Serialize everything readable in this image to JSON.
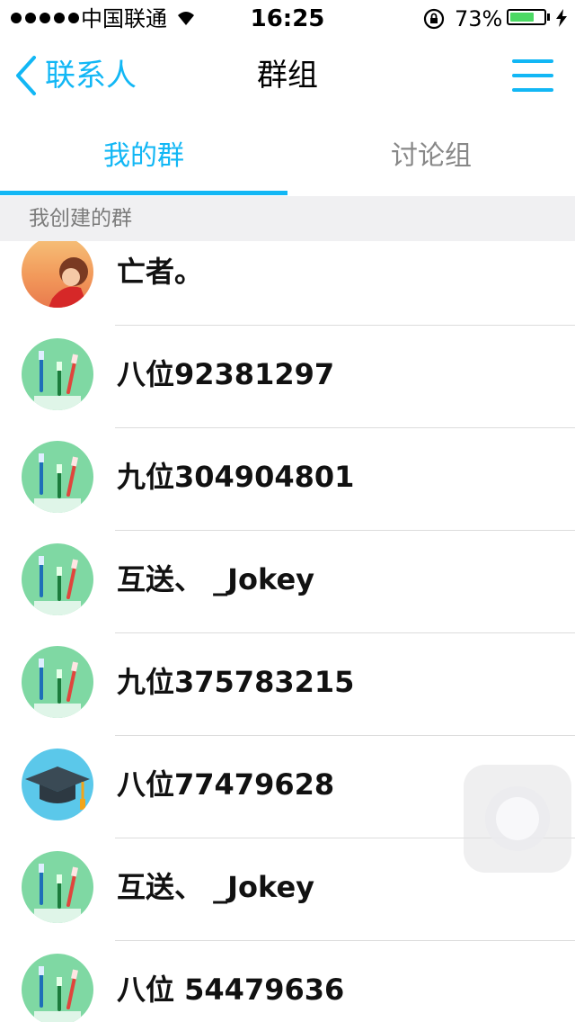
{
  "status_bar": {
    "carrier": "中国联通",
    "time": "16:25",
    "battery_percent": "73%",
    "battery_level": 0.73,
    "icons": [
      "signal-dots-icon",
      "wifi-icon",
      "rotation-lock-icon",
      "battery-icon",
      "charging-bolt-icon"
    ]
  },
  "nav": {
    "back_label": "联系人",
    "title": "群组",
    "accent_color": "#12b7f5"
  },
  "tabs": [
    {
      "label": "我的群",
      "active": true
    },
    {
      "label": "讨论组",
      "active": false
    }
  ],
  "section": {
    "title": "我创建的群"
  },
  "groups": [
    {
      "name": "亡者。",
      "avatar": "photo-avatar"
    },
    {
      "name": "八位92381297",
      "avatar": "toothbrush-avatar"
    },
    {
      "name": "九位304904801",
      "avatar": "toothbrush-avatar"
    },
    {
      "name": "互送、 _Jokey",
      "avatar": "toothbrush-avatar"
    },
    {
      "name": "九位375783215",
      "avatar": "toothbrush-avatar"
    },
    {
      "name": "八位77479628",
      "avatar": "graduation-cap-avatar"
    },
    {
      "name": "互送、 _Jokey",
      "avatar": "toothbrush-avatar"
    },
    {
      "name": "八位 54479636",
      "avatar": "toothbrush-avatar"
    }
  ]
}
